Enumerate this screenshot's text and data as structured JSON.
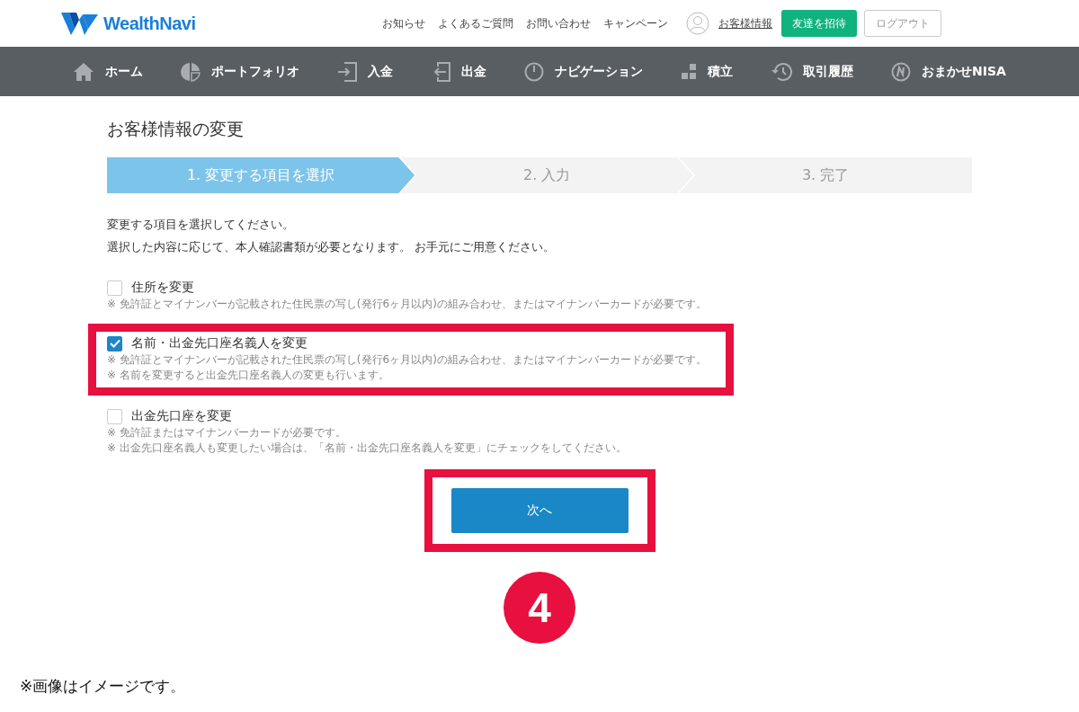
{
  "header": {
    "logo": "WealthNavi",
    "links": [
      "お知らせ",
      "よくあるご質問",
      "お問い合わせ",
      "キャンペーン"
    ],
    "account_link": "お客様情報",
    "invite_button": "友達を招待",
    "logout_button": "ログアウト"
  },
  "nav": [
    {
      "label": "ホーム",
      "kind": "home"
    },
    {
      "label": "ポートフォリオ",
      "kind": "portfolio"
    },
    {
      "label": "入金",
      "kind": "deposit"
    },
    {
      "label": "出金",
      "kind": "withdraw"
    },
    {
      "label": "ナビゲーション",
      "kind": "navigation"
    },
    {
      "label": "積立",
      "kind": "saving"
    },
    {
      "label": "取引履歴",
      "kind": "history"
    },
    {
      "label": "おまかせNISA",
      "kind": "nisa"
    }
  ],
  "page_title": "お客様情報の変更",
  "steps": [
    {
      "label": "1. 変更する項目を選択",
      "selected": true
    },
    {
      "label": "2. 入力",
      "selected": false
    },
    {
      "label": "3. 完了",
      "selected": false
    }
  ],
  "intro": [
    "変更する項目を選択してください。",
    "選択した内容に応じて、本人確認書類が必要となります。 お手元にご用意ください。"
  ],
  "options": [
    {
      "label": "住所を変更",
      "checked": false,
      "highlighted": false,
      "notes": [
        "※ 免許証とマイナンバーが記載された住民票の写し(発行6ヶ月以内)の組み合わせ、またはマイナンバーカードが必要です。"
      ]
    },
    {
      "label": "名前・出金先口座名義人を変更",
      "checked": true,
      "highlighted": true,
      "notes": [
        "※ 免許証とマイナンバーが記載された住民票の写し(発行6ヶ月以内)の組み合わせ、またはマイナンバーカードが必要です。",
        "※ 名前を変更すると出金先口座名義人の変更も行います。"
      ]
    },
    {
      "label": "出金先口座を変更",
      "checked": false,
      "highlighted": false,
      "notes": [
        "※ 免許証またはマイナンバーカードが必要です。",
        "※ 出金先口座名義人も変更したい場合は、「名前・出金先口座名義人を変更」にチェックをしてください。"
      ]
    }
  ],
  "next_button": {
    "label": "次へ",
    "highlighted": true
  },
  "step_badge": "4",
  "footnote": "※画像はイメージです。"
}
